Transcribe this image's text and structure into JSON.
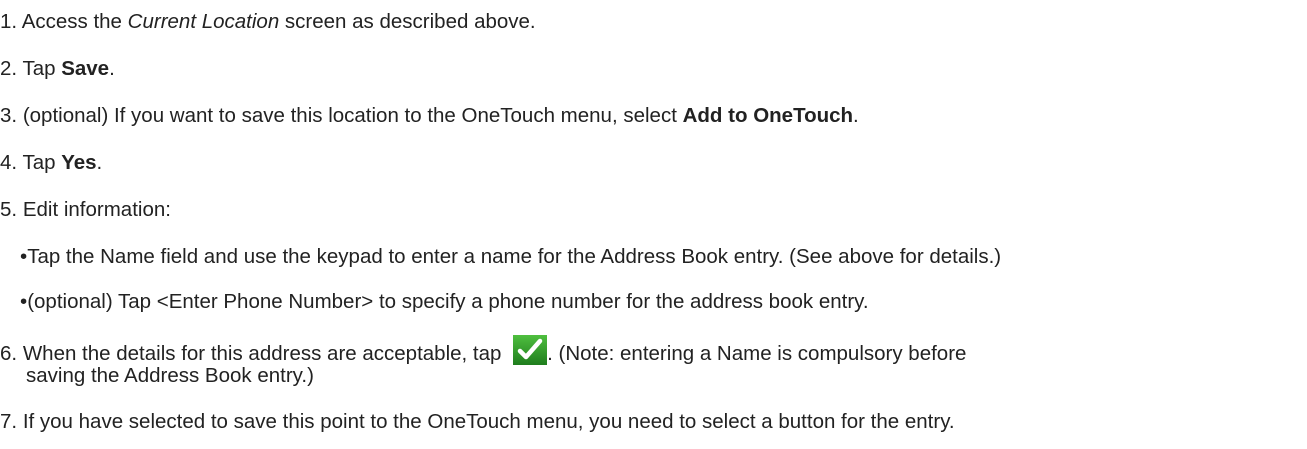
{
  "steps": [
    {
      "num": "1.",
      "pre": "Access the ",
      "italic": "Current Location",
      "post": " screen as described above."
    },
    {
      "num": "2.",
      "pre": "Tap ",
      "bold": "Save",
      "post": "."
    },
    {
      "num": "3.",
      "pre": "(optional) If you want to save this location to the OneTouch menu, select ",
      "bold": "Add to OneTouch",
      "post": "."
    },
    {
      "num": "4.",
      "pre": "Tap ",
      "bold": "Yes",
      "post": "."
    },
    {
      "num": "5.",
      "text": "Edit information:"
    },
    {
      "num": "6.",
      "pre": "When the details for this address are acceptable, tap ",
      "post": ".   (Note: entering a Name is compulsory before",
      "cont": "saving the Address Book entry.)"
    },
    {
      "num": "7.",
      "text": "If you have selected to save this point to the OneTouch menu, you need to select a button for the entry."
    }
  ],
  "bullets": [
    "Tap the Name field and use the keypad to enter a name for the Address Book entry. (See above for details.)",
    "(optional) Tap <Enter Phone Number> to specify a phone number for the address book entry."
  ],
  "bullet_char": "•",
  "icons": {
    "confirm": "green-checkmark-icon"
  },
  "colors": {
    "text": "#222222",
    "check_bg": "#2e9a2a",
    "check_mark": "#ffffff"
  }
}
